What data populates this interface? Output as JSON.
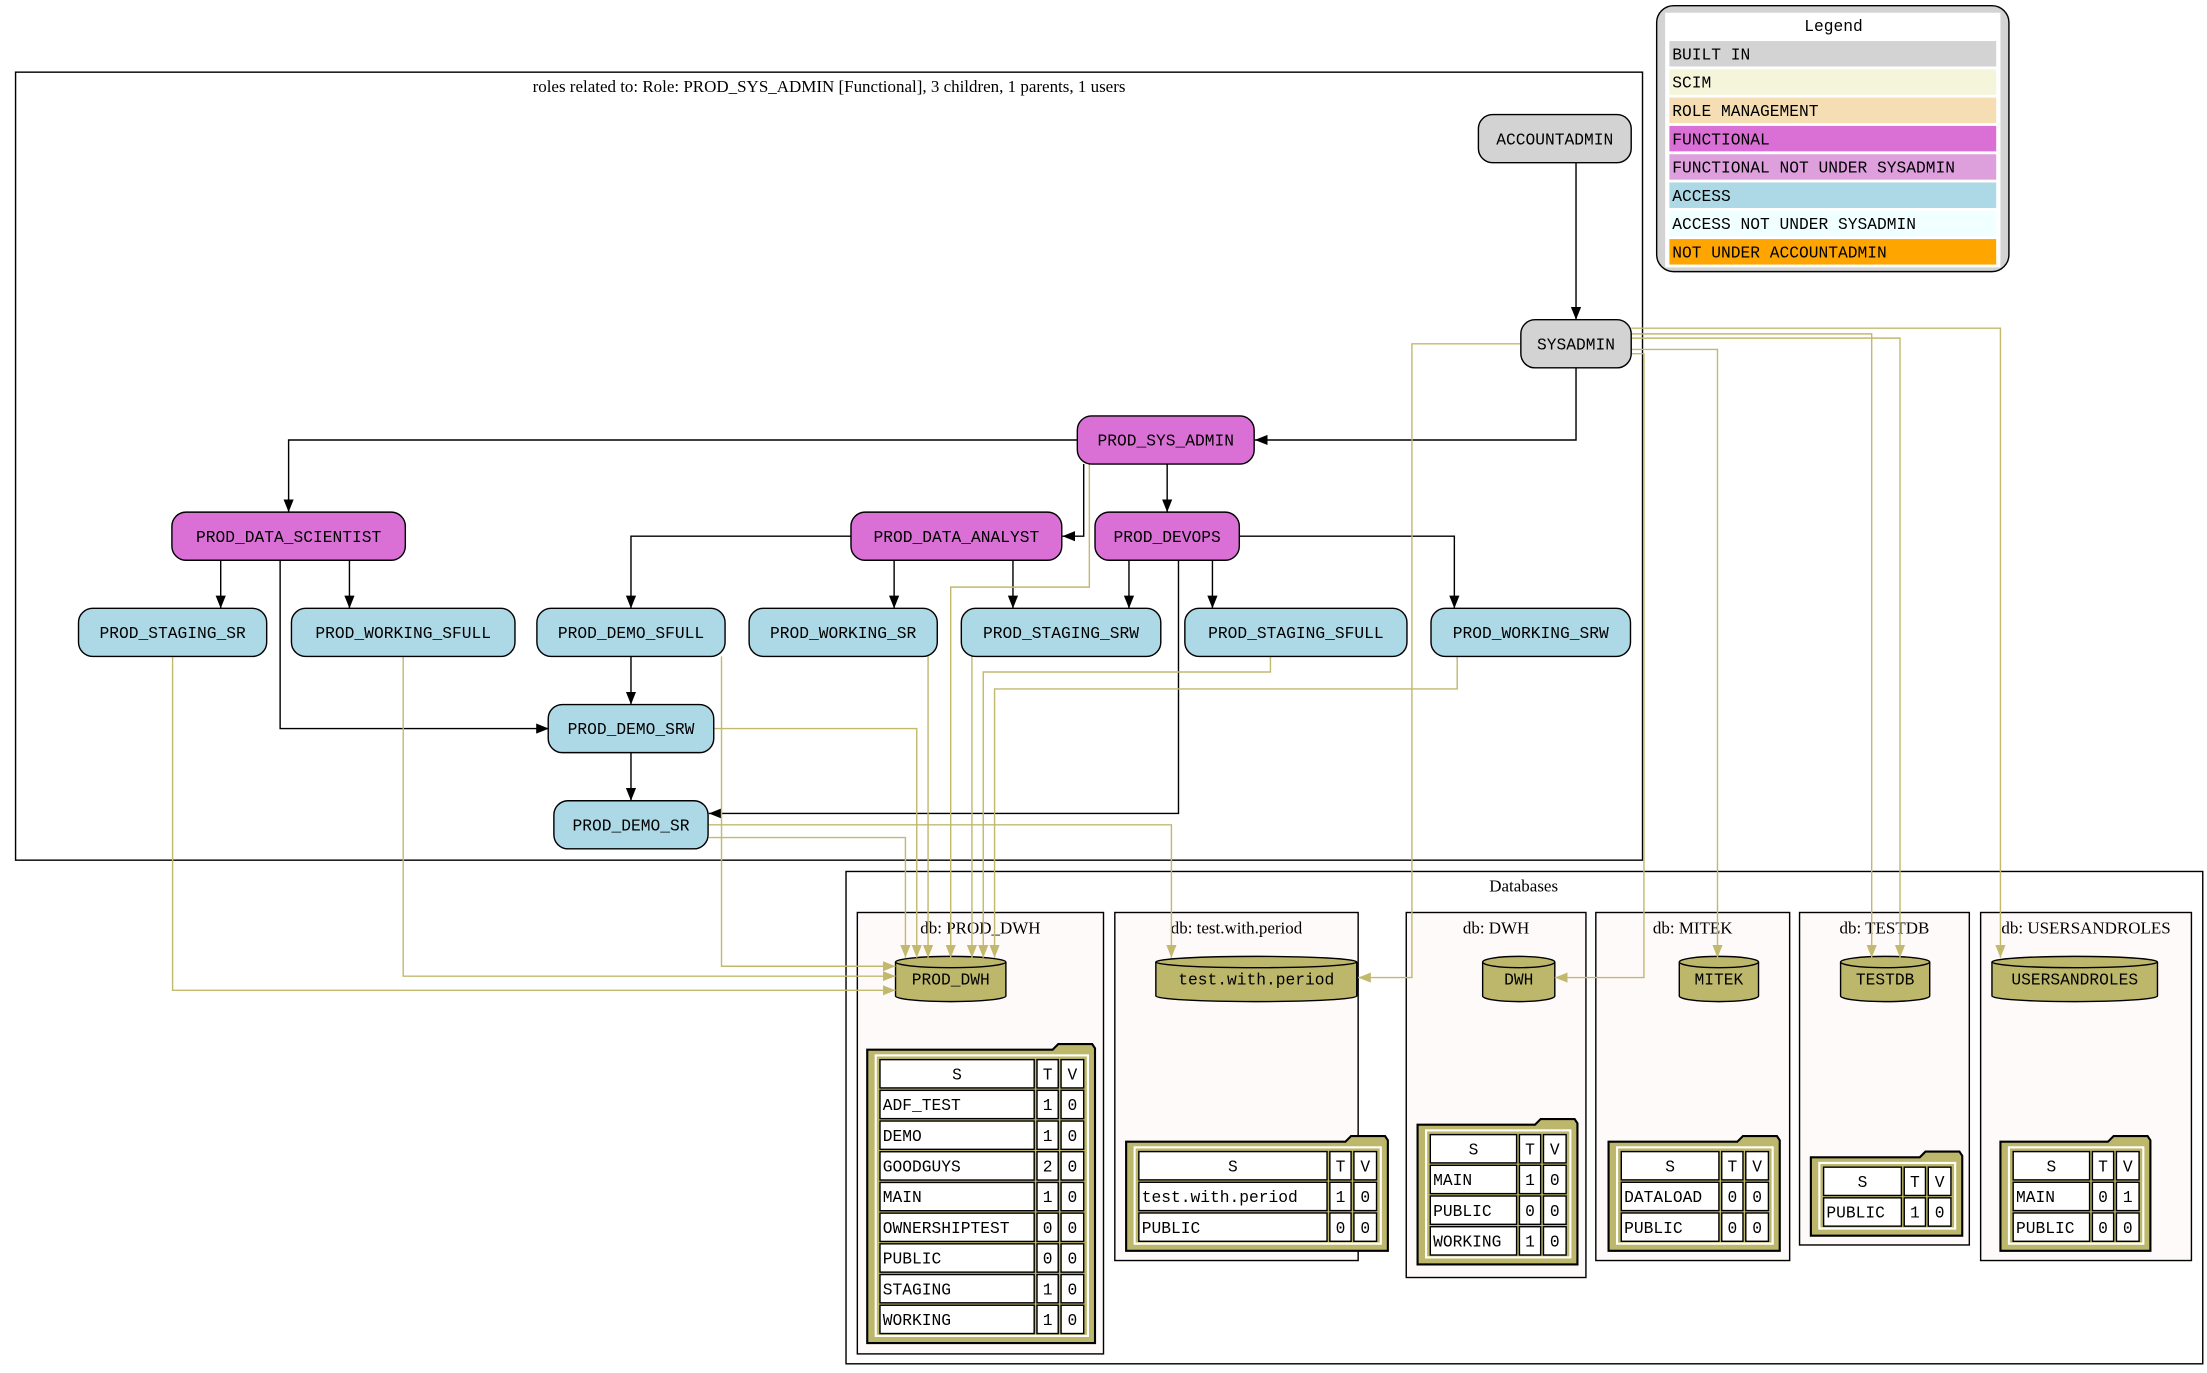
{
  "roles_cluster": {
    "title": "roles related to: Role: PROD_SYS_ADMIN [Functional], 3 children, 1 parents, 1 users"
  },
  "colors": {
    "built_in": "#d3d3d3",
    "functional": "#da70d6",
    "access": "#add8e6",
    "database": "#bdb76b",
    "db_edge": "#c2b96e",
    "db_cluster_bg": "#fffafa"
  },
  "legend": {
    "title": "Legend",
    "items": [
      {
        "label": "BUILT IN",
        "color": "#d3d3d3"
      },
      {
        "label": "SCIM",
        "color": "#f5f5dc"
      },
      {
        "label": "ROLE MANAGEMENT",
        "color": "#f5deb3"
      },
      {
        "label": "FUNCTIONAL",
        "color": "#da70d6"
      },
      {
        "label": "FUNCTIONAL NOT UNDER SYSADMIN",
        "color": "#dda0dd"
      },
      {
        "label": "ACCESS",
        "color": "#add8e6"
      },
      {
        "label": "ACCESS NOT UNDER SYSADMIN",
        "color": "#f0ffff"
      },
      {
        "label": "NOT UNDER ACCOUNTADMIN",
        "color": "#ffa500"
      }
    ]
  },
  "roles": [
    {
      "id": "ACCOUNTADMIN",
      "label": "ACCOUNTADMIN",
      "type": "built_in"
    },
    {
      "id": "SYSADMIN",
      "label": "SYSADMIN",
      "type": "built_in"
    },
    {
      "id": "PROD_SYS_ADMIN",
      "label": "PROD_SYS_ADMIN",
      "type": "functional"
    },
    {
      "id": "PROD_DATA_SCIENTIST",
      "label": "PROD_DATA_SCIENTIST",
      "type": "functional"
    },
    {
      "id": "PROD_DATA_ANALYST",
      "label": "PROD_DATA_ANALYST",
      "type": "functional"
    },
    {
      "id": "PROD_DEVOPS",
      "label": "PROD_DEVOPS",
      "type": "functional"
    },
    {
      "id": "PROD_STAGING_SR",
      "label": "PROD_STAGING_SR",
      "type": "access"
    },
    {
      "id": "PROD_WORKING_SFULL",
      "label": "PROD_WORKING_SFULL",
      "type": "access"
    },
    {
      "id": "PROD_DEMO_SFULL",
      "label": "PROD_DEMO_SFULL",
      "type": "access"
    },
    {
      "id": "PROD_WORKING_SR",
      "label": "PROD_WORKING_SR",
      "type": "access"
    },
    {
      "id": "PROD_STAGING_SRW",
      "label": "PROD_STAGING_SRW",
      "type": "access"
    },
    {
      "id": "PROD_STAGING_SFULL",
      "label": "PROD_STAGING_SFULL",
      "type": "access"
    },
    {
      "id": "PROD_WORKING_SRW",
      "label": "PROD_WORKING_SRW",
      "type": "access"
    },
    {
      "id": "PROD_DEMO_SRW",
      "label": "PROD_DEMO_SRW",
      "type": "access"
    },
    {
      "id": "PROD_DEMO_SR",
      "label": "PROD_DEMO_SR",
      "type": "access"
    }
  ],
  "edges": [
    {
      "from": "ACCOUNTADMIN",
      "to": "SYSADMIN",
      "kind": "role"
    },
    {
      "from": "SYSADMIN",
      "to": "PROD_SYS_ADMIN",
      "kind": "role"
    },
    {
      "from": "PROD_SYS_ADMIN",
      "to": "PROD_DATA_SCIENTIST",
      "kind": "role"
    },
    {
      "from": "PROD_SYS_ADMIN",
      "to": "PROD_DATA_ANALYST",
      "kind": "role"
    },
    {
      "from": "PROD_SYS_ADMIN",
      "to": "PROD_DEVOPS",
      "kind": "role"
    },
    {
      "from": "PROD_DATA_SCIENTIST",
      "to": "PROD_STAGING_SR",
      "kind": "role"
    },
    {
      "from": "PROD_DATA_SCIENTIST",
      "to": "PROD_WORKING_SFULL",
      "kind": "role"
    },
    {
      "from": "PROD_DATA_SCIENTIST",
      "to": "PROD_DEMO_SRW",
      "kind": "role"
    },
    {
      "from": "PROD_DATA_ANALYST",
      "to": "PROD_DEMO_SFULL",
      "kind": "role"
    },
    {
      "from": "PROD_DATA_ANALYST",
      "to": "PROD_WORKING_SR",
      "kind": "role"
    },
    {
      "from": "PROD_DATA_ANALYST",
      "to": "PROD_STAGING_SRW",
      "kind": "role"
    },
    {
      "from": "PROD_DEVOPS",
      "to": "PROD_STAGING_SRW",
      "kind": "role"
    },
    {
      "from": "PROD_DEVOPS",
      "to": "PROD_STAGING_SFULL",
      "kind": "role"
    },
    {
      "from": "PROD_DEVOPS",
      "to": "PROD_WORKING_SRW",
      "kind": "role"
    },
    {
      "from": "PROD_DEVOPS",
      "to": "PROD_DEMO_SR",
      "kind": "role"
    },
    {
      "from": "PROD_DEMO_SFULL",
      "to": "PROD_DEMO_SRW",
      "kind": "role"
    },
    {
      "from": "PROD_DEMO_SRW",
      "to": "PROD_DEMO_SR",
      "kind": "role"
    },
    {
      "from": "PROD_STAGING_SR",
      "to": "PROD_DWH",
      "kind": "db"
    },
    {
      "from": "PROD_WORKING_SFULL",
      "to": "PROD_DWH",
      "kind": "db"
    },
    {
      "from": "PROD_DEMO_SFULL",
      "to": "PROD_DWH",
      "kind": "db"
    },
    {
      "from": "PROD_DEMO_SRW",
      "to": "PROD_DWH",
      "kind": "db"
    },
    {
      "from": "PROD_DEMO_SR",
      "to": "PROD_DWH",
      "kind": "db"
    },
    {
      "from": "PROD_DEMO_SR",
      "to": "test.with.period",
      "kind": "db"
    },
    {
      "from": "PROD_WORKING_SR",
      "to": "PROD_DWH",
      "kind": "db"
    },
    {
      "from": "PROD_SYS_ADMIN",
      "to": "PROD_DWH",
      "kind": "db"
    },
    {
      "from": "PROD_STAGING_SRW",
      "to": "PROD_DWH",
      "kind": "db"
    },
    {
      "from": "PROD_STAGING_SFULL",
      "to": "PROD_DWH",
      "kind": "db"
    },
    {
      "from": "PROD_WORKING_SRW",
      "to": "PROD_DWH",
      "kind": "db"
    },
    {
      "from": "SYSADMIN",
      "to": "test.with.period",
      "kind": "db"
    },
    {
      "from": "SYSADMIN",
      "to": "DWH",
      "kind": "db"
    },
    {
      "from": "SYSADMIN",
      "to": "MITEK",
      "kind": "db"
    },
    {
      "from": "SYSADMIN",
      "to": "TESTDB",
      "kind": "db"
    },
    {
      "from": "SYSADMIN",
      "to": "TESTDB",
      "kind": "db"
    },
    {
      "from": "SYSADMIN",
      "to": "USERSANDROLES",
      "kind": "db"
    }
  ],
  "databases": {
    "title": "Databases",
    "items": [
      {
        "cluster_title": "db: PROD_DWH",
        "name": "PROD_DWH",
        "columns": [
          "S",
          "T",
          "V"
        ],
        "schemas": [
          [
            "ADF_TEST",
            "1",
            "0"
          ],
          [
            "DEMO",
            "1",
            "0"
          ],
          [
            "GOODGUYS",
            "2",
            "0"
          ],
          [
            "MAIN",
            "1",
            "0"
          ],
          [
            "OWNERSHIPTEST",
            "0",
            "0"
          ],
          [
            "PUBLIC",
            "0",
            "0"
          ],
          [
            "STAGING",
            "1",
            "0"
          ],
          [
            "WORKING",
            "1",
            "0"
          ]
        ]
      },
      {
        "cluster_title": "db: test.with.period",
        "name": "test.with.period",
        "columns": [
          "S",
          "T",
          "V"
        ],
        "schemas": [
          [
            "test.with.period",
            "1",
            "0"
          ],
          [
            "PUBLIC",
            "0",
            "0"
          ]
        ]
      },
      {
        "cluster_title": "db: DWH",
        "name": "DWH",
        "columns": [
          "S",
          "T",
          "V"
        ],
        "schemas": [
          [
            "MAIN",
            "1",
            "0"
          ],
          [
            "PUBLIC",
            "0",
            "0"
          ],
          [
            "WORKING",
            "1",
            "0"
          ]
        ]
      },
      {
        "cluster_title": "db: MITEK",
        "name": "MITEK",
        "columns": [
          "S",
          "T",
          "V"
        ],
        "schemas": [
          [
            "DATALOAD",
            "0",
            "0"
          ],
          [
            "PUBLIC",
            "0",
            "0"
          ]
        ]
      },
      {
        "cluster_title": "db: TESTDB",
        "name": "TESTDB",
        "columns": [
          "S",
          "T",
          "V"
        ],
        "schemas": [
          [
            "PUBLIC",
            "1",
            "0"
          ]
        ]
      },
      {
        "cluster_title": "db: USERSANDROLES",
        "name": "USERSANDROLES",
        "columns": [
          "S",
          "T",
          "V"
        ],
        "schemas": [
          [
            "MAIN",
            "0",
            "1"
          ],
          [
            "PUBLIC",
            "0",
            "0"
          ]
        ]
      }
    ]
  }
}
